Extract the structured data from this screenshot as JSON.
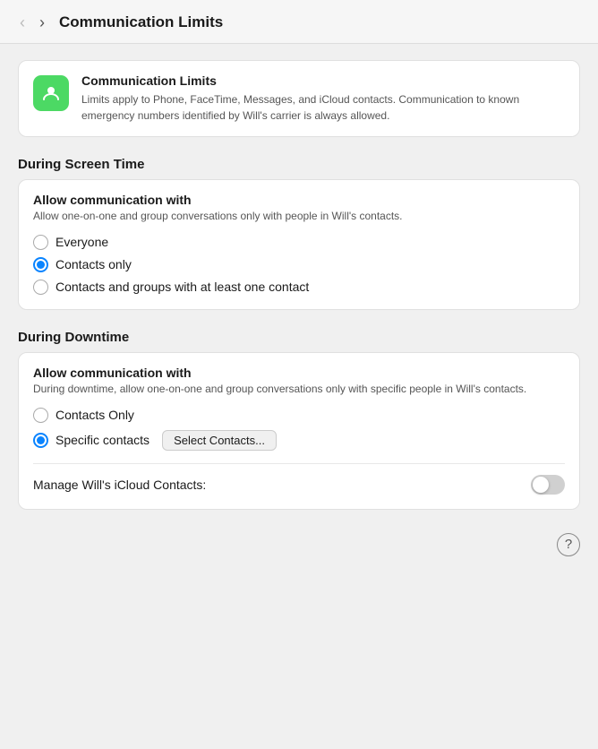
{
  "titleBar": {
    "title": "Communication Limits",
    "backLabel": "‹",
    "forwardLabel": "›"
  },
  "infoCard": {
    "title": "Communication Limits",
    "description": "Limits apply to Phone, FaceTime, Messages, and iCloud contacts. Communication to known emergency numbers identified by Will's carrier is always allowed."
  },
  "screenTime": {
    "sectionHeading": "During Screen Time",
    "cardTitle": "Allow communication with",
    "cardSubtitle": "Allow one-on-one and group conversations only with people in Will's contacts.",
    "options": [
      {
        "id": "everyone",
        "label": "Everyone",
        "selected": false
      },
      {
        "id": "contacts-only",
        "label": "Contacts only",
        "selected": true
      },
      {
        "id": "contacts-groups",
        "label": "Contacts and groups with at least one contact",
        "selected": false
      }
    ]
  },
  "downtime": {
    "sectionHeading": "During Downtime",
    "cardTitle": "Allow communication with",
    "cardSubtitle": "During downtime, allow one-on-one and group conversations only with specific people in Will's contacts.",
    "options": [
      {
        "id": "contacts-only-dt",
        "label": "Contacts Only",
        "selected": false
      },
      {
        "id": "specific-contacts",
        "label": "Specific contacts",
        "selected": true
      }
    ],
    "selectButton": "Select Contacts...",
    "manageLabel": "Manage Will's iCloud Contacts:",
    "toggleOn": false
  },
  "helpButton": "?"
}
